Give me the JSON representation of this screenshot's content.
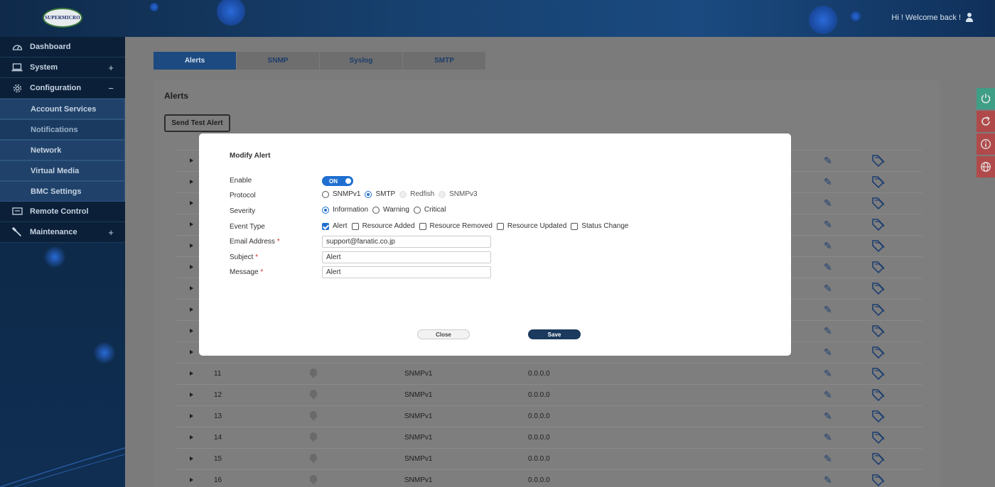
{
  "header": {
    "logo_text": "SUPERMICRO",
    "welcome": "Hi ! Welcome back !"
  },
  "sidebar": {
    "items": [
      {
        "label": "Dashboard",
        "icon": "dashboard-gauge-icon",
        "toggle": ""
      },
      {
        "label": "System",
        "icon": "laptop-icon",
        "toggle": "+"
      },
      {
        "label": "Configuration",
        "icon": "gear-icon",
        "toggle": "−"
      },
      {
        "label": "Remote Control",
        "icon": "monitor-icon",
        "toggle": ""
      },
      {
        "label": "Maintenance",
        "icon": "wrench-icon",
        "toggle": "+"
      }
    ],
    "config_sub": [
      "Account Services",
      "Notifications",
      "Network",
      "Virtual Media",
      "BMC Settings"
    ]
  },
  "tabs": [
    "Alerts",
    "SNMP",
    "Syslog",
    "SMTP"
  ],
  "panel": {
    "title": "Alerts",
    "send_test": "Send Test Alert"
  },
  "table": {
    "rows": [
      {
        "id": "11",
        "protocol": "SNMPv1",
        "destination": "0.0.0.0"
      },
      {
        "id": "12",
        "protocol": "SNMPv1",
        "destination": "0.0.0.0"
      },
      {
        "id": "13",
        "protocol": "SNMPv1",
        "destination": "0.0.0.0"
      },
      {
        "id": "14",
        "protocol": "SNMPv1",
        "destination": "0.0.0.0"
      },
      {
        "id": "15",
        "protocol": "SNMPv1",
        "destination": "0.0.0.0"
      },
      {
        "id": "16",
        "protocol": "SNMPv1",
        "destination": "0.0.0.0"
      }
    ]
  },
  "modal": {
    "title": "Modify Alert",
    "labels": {
      "enable": "Enable",
      "protocol": "Protocol",
      "severity": "Severity",
      "event_type": "Event Type",
      "email": "Email Address",
      "subject": "Subject",
      "message": "Message",
      "required_mark": "*"
    },
    "toggle": "ON",
    "protocol_options": [
      "SNMPv1",
      "SMTP",
      "Redfish",
      "SNMPv3"
    ],
    "protocol_selected": "SMTP",
    "severity_options": [
      "Information",
      "Warning",
      "Critical"
    ],
    "severity_selected": "Information",
    "event_types": [
      "Alert",
      "Resource Added",
      "Resource Removed",
      "Resource Updated",
      "Status Change"
    ],
    "event_checked": [
      "Alert"
    ],
    "email_value": "support@fanatic.co.jp",
    "subject_value": "Alert",
    "message_value": "Alert",
    "close": "Close",
    "save": "Save"
  },
  "right_buttons": [
    {
      "icon": "power-icon",
      "color": "#3e9e86"
    },
    {
      "icon": "refresh-icon",
      "color": "#b04a4a"
    },
    {
      "icon": "info-icon",
      "color": "#b04a4a"
    },
    {
      "icon": "globe-icon",
      "color": "#b04a4a"
    }
  ],
  "colors": {
    "accent": "#1f6fd0",
    "save_button": "#1b3a5e",
    "tab_active": "#1d4a80",
    "required": "#d0312d"
  }
}
